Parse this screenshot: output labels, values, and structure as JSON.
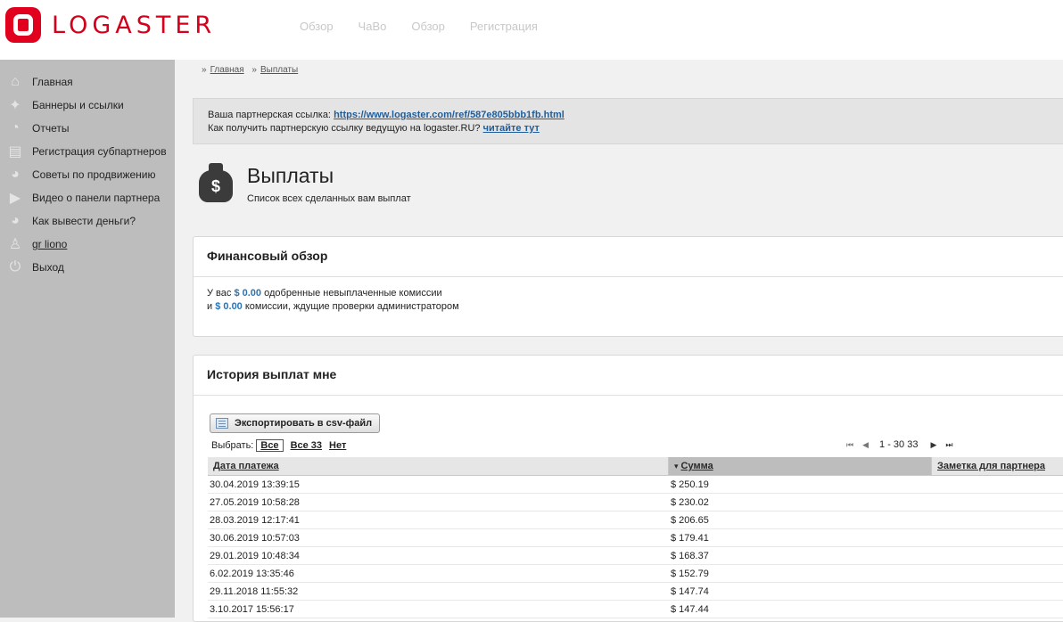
{
  "header": {
    "logo_text": "LOGASTER",
    "nav": [
      "Обзор",
      "ЧаВо",
      "Обзор",
      "Регистрация"
    ]
  },
  "sidebar": {
    "items": [
      {
        "label": "Главная",
        "icon": "home-icon"
      },
      {
        "label": "Баннеры и ссылки",
        "icon": "banner-icon"
      },
      {
        "label": "Отчеты",
        "icon": "pie-chart-icon"
      },
      {
        "label": "Регистрация субпартнеров",
        "icon": "register-icon"
      },
      {
        "label": "Советы по продвижению",
        "icon": "chart-icon"
      },
      {
        "label": "Видео о панели партнера",
        "icon": "video-icon"
      },
      {
        "label": "Как вывести деньги?",
        "icon": "chart-icon"
      },
      {
        "label": "gr liono",
        "icon": "user-icon"
      },
      {
        "label": "Выход",
        "icon": "power-icon"
      }
    ]
  },
  "breadcrumb": {
    "home": "Главная",
    "current": "Выплаты"
  },
  "ref": {
    "prefix": "Ваша партнерская ссылка:",
    "link": "https://www.logaster.com/ref/587e805bbb1fb.html",
    "question": "Как получить партнерскую ссылку ведущую на logaster.RU?",
    "read_link": "читайте тут"
  },
  "page": {
    "title": "Выплаты",
    "subtitle": "Список всех сделанных вам выплат"
  },
  "financial": {
    "title": "Финансовый обзор",
    "line1_prefix": "У вас",
    "approved": "$ 0.00",
    "line1_suffix": "одобренные невыплаченные комиссии",
    "line2_prefix": "и",
    "pending": "$ 0.00",
    "line2_suffix": "комиссии, ждущие проверки администратором"
  },
  "history": {
    "title": "История выплат мне",
    "export_label": "Экспортировать в csv-файл",
    "select_label": "Выбрать:",
    "select_all": "Все",
    "select_all33": "Все 33",
    "select_none": "Нет",
    "pager_range": "1 - 30 33",
    "columns": [
      "Дата платежа",
      "Сумма",
      "Заметка для партнера"
    ],
    "rows": [
      {
        "date": "30.04.2019 13:39:15",
        "amount": "$ 250.19"
      },
      {
        "date": "27.05.2019 10:58:28",
        "amount": "$ 230.02"
      },
      {
        "date": "28.03.2019 12:17:41",
        "amount": "$ 206.65"
      },
      {
        "date": "30.06.2019 10:57:03",
        "amount": "$ 179.41"
      },
      {
        "date": "29.01.2019 10:48:34",
        "amount": "$ 168.37"
      },
      {
        "date": "6.02.2019 13:35:46",
        "amount": "$ 152.79"
      },
      {
        "date": "29.11.2018 11:55:32",
        "amount": "$ 147.74"
      },
      {
        "date": "3.10.2017 15:56:17",
        "amount": "$ 147.44"
      }
    ]
  },
  "colors": {
    "brand": "#e1001e",
    "link": "#1f5d9b",
    "money": "#2c74b3",
    "sidebar": "#bdbdbd"
  }
}
